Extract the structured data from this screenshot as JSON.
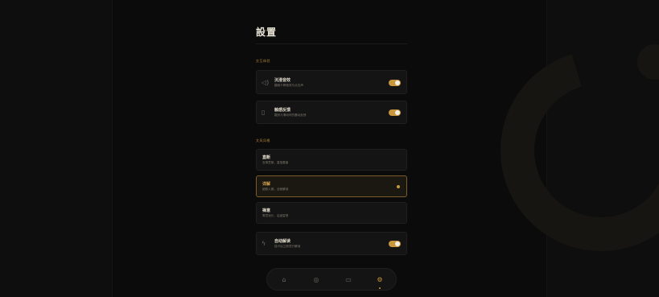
{
  "app": {
    "title": "設置"
  },
  "sections": {
    "interaction": {
      "label": "交互体验"
    },
    "style": {
      "label": "文风风格"
    }
  },
  "settings": {
    "sound": {
      "icon": "speaker-icon",
      "title": "沉浸音效",
      "subtitle": "翻阅卡牌音效与点击声",
      "enabled": true
    },
    "haptics": {
      "icon": "phone-vibrate-icon",
      "title": "触感反馈",
      "subtitle": "翻页与滑动时的震动反馈",
      "enabled": true
    },
    "auto_interpret": {
      "icon": "lightning-icon",
      "title": "自动解读",
      "subtitle": "抽卡后立即进行解读",
      "enabled": true
    }
  },
  "styles": [
    {
      "title": "直断",
      "subtitle": "言简意赅，直指要害",
      "selected": false
    },
    {
      "title": "详解",
      "subtitle": "细致入微，全面解读",
      "selected": true
    },
    {
      "title": "禅意",
      "subtitle": "寓意深长，启迪智慧",
      "selected": false
    }
  ],
  "nav": [
    {
      "icon": "home-icon",
      "glyph": "⌂",
      "active": false
    },
    {
      "icon": "compass-icon",
      "glyph": "◎",
      "active": false
    },
    {
      "icon": "chat-icon",
      "glyph": "▭",
      "active": false
    },
    {
      "icon": "gear-icon",
      "glyph": "⚙",
      "active": true
    }
  ],
  "colors": {
    "accent": "#c8963c",
    "background": "#0b0b0b",
    "card": "#141414"
  }
}
